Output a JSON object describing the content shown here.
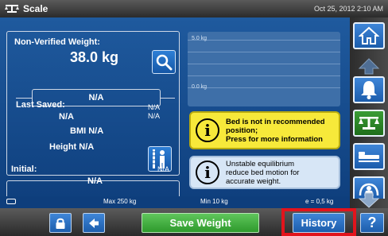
{
  "titlebar": {
    "title": "Scale",
    "datetime": "Oct 25, 2012 2:10 AM"
  },
  "weight": {
    "label": "Non-Verified Weight:",
    "value": "38.0 kg",
    "secondary": "N/A"
  },
  "last_saved": {
    "label": "Last Saved:",
    "value": "N/A",
    "right_top": "N/A",
    "right_bottom": "N/A",
    "bmi": "BMI N/A",
    "height": "Height N/A"
  },
  "initial": {
    "label": "Initial:",
    "value": "N/A",
    "right": "N/A"
  },
  "graph": {
    "top_label": "5.0 kg",
    "bottom_label": "0.0 kg"
  },
  "alerts": {
    "warning_text_1": "Bed is not in recommended",
    "warning_text_2": "position;",
    "warning_text_3": "Press for more information",
    "info_text_1": "Unstable equilibrium",
    "info_text_2": "reduce bed motion for",
    "info_text_3": "accurate weight."
  },
  "status": {
    "max": "Max 250 kg",
    "min": "Min 10 kg",
    "e": "e = 0,5 kg"
  },
  "buttons": {
    "save": "Save Weight",
    "history": "History",
    "help": "?"
  },
  "colors": {
    "main_blue": "#1f5a9e",
    "save_green": "#2e9a2c",
    "highlight_red": "#e2141c",
    "warning_yellow": "#f7e93a"
  },
  "icons": {
    "title": "scale-icon",
    "search": "magnifier-icon",
    "person": "person-height-icon",
    "lock": "lock-icon",
    "back": "arrow-left-icon",
    "home": "home-icon",
    "up": "arrow-up-icon",
    "bell": "bell-icon",
    "scale": "scale-icon",
    "bed": "bed-icon",
    "person_bed": "patient-icon",
    "down": "arrow-down-icon"
  }
}
